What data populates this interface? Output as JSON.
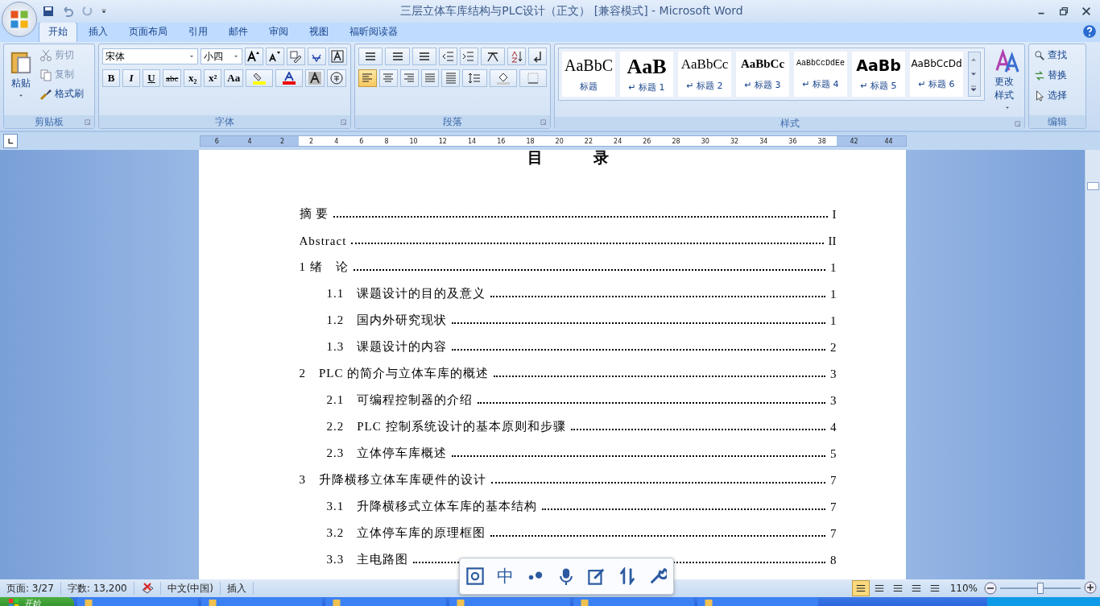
{
  "window": {
    "title": "三层立体车库结构与PLC设计（正文） [兼容模式] - Microsoft Word"
  },
  "tabs": [
    {
      "label": "开始",
      "selected": true
    },
    {
      "label": "插入",
      "selected": false
    },
    {
      "label": "页面布局",
      "selected": false
    },
    {
      "label": "引用",
      "selected": false
    },
    {
      "label": "邮件",
      "selected": false
    },
    {
      "label": "审阅",
      "selected": false
    },
    {
      "label": "视图",
      "selected": false
    },
    {
      "label": "福昕阅读器",
      "selected": false
    }
  ],
  "ribbon": {
    "clipboard": {
      "label": "剪贴板",
      "paste": "粘贴",
      "items": [
        "剪切",
        "复制",
        "格式刷"
      ]
    },
    "font": {
      "label": "字体",
      "font_name": "宋体",
      "font_size": "小四",
      "format_buttons": [
        "B",
        "I",
        "U",
        "abc",
        "x₂",
        "x²",
        "Aa"
      ]
    },
    "paragraph": {
      "label": "段落",
      "alignment_buttons": [
        {
          "selected": true
        },
        {
          "selected": false
        },
        {
          "selected": false
        },
        {
          "selected": false
        },
        {
          "selected": false
        }
      ]
    },
    "styles": {
      "label": "样式",
      "gallery": [
        {
          "preview": "AaBbC",
          "name": "标题"
        },
        {
          "preview": "AaB",
          "name": "↵ 标题 1"
        },
        {
          "preview": "AaBbCc",
          "name": "↵ 标题 2"
        },
        {
          "preview": "AaBbCc",
          "name": "↵ 标题 3"
        },
        {
          "preview": "AaBbCcDdEe",
          "name": "↵ 标题 4"
        },
        {
          "preview": "AaBb",
          "name": "↵ 标题 5"
        },
        {
          "preview": "AaBbCcDd",
          "name": "↵ 标题 6"
        }
      ],
      "change_styles": "更改样式"
    },
    "editing": {
      "label": "编辑",
      "items": [
        "查找",
        "替换",
        "选择"
      ]
    }
  },
  "ruler": {
    "left_ticks": [
      "6",
      "4",
      "2"
    ],
    "ticks": [
      "2",
      "4",
      "6",
      "8",
      "10",
      "12",
      "14",
      "16",
      "18",
      "20",
      "22",
      "24",
      "26",
      "28",
      "30",
      "32",
      "34",
      "36",
      "38"
    ],
    "right_ticks": [
      "42",
      "44"
    ]
  },
  "document": {
    "title": "目　录",
    "toc": [
      {
        "title": "摘 要",
        "page": "I"
      },
      {
        "title": "Abstract",
        "page": "II"
      },
      {
        "title": "1 绪　论",
        "page": "1",
        "children": [
          {
            "title": "1.1　课题设计的目的及意义",
            "page": "1"
          },
          {
            "title": "1.2　国内外研究现状",
            "page": "1"
          },
          {
            "title": "1.3　课题设计的内容",
            "page": "2"
          }
        ]
      },
      {
        "title": "2　PLC 的简介与立体车库的概述",
        "page": "3",
        "children": [
          {
            "title": "2.1　可编程控制器的介绍",
            "page": "3"
          },
          {
            "title": "2.2　PLC 控制系统设计的基本原则和步骤",
            "page": "4"
          },
          {
            "title": "2.3　立体停车库概述",
            "page": "5"
          }
        ]
      },
      {
        "title": "3　升降横移立体车库硬件的设计",
        "page": "7",
        "children": [
          {
            "title": "3.1　升降横移式立体车库的基本结构",
            "page": "7"
          },
          {
            "title": "3.2　立体停车库的原理框图",
            "page": "7"
          },
          {
            "title": "3.3　主电路图",
            "page": "8"
          }
        ]
      }
    ]
  },
  "status_bar": {
    "page": "页面: 3/27",
    "words": "字数: 13,200",
    "language": "中文(中国)",
    "mode": "插入",
    "view_buttons": [
      {
        "selected": true
      },
      {
        "selected": false
      },
      {
        "selected": false
      },
      {
        "selected": false
      },
      {
        "selected": false
      }
    ],
    "zoom": "110%",
    "zoom_slider": {
      "level": 0.5
    }
  },
  "ime_toolbar": {
    "mode": "中"
  },
  "taskbar": {
    "start": "开始"
  }
}
